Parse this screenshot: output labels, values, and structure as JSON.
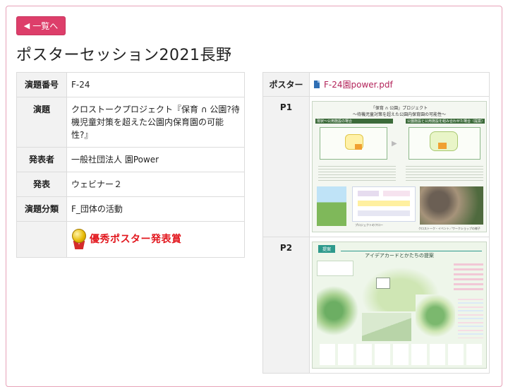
{
  "back_button": {
    "label": "一覧へ"
  },
  "page_title": "ポスターセッション2021長野",
  "info": {
    "rows": [
      {
        "label": "演題番号",
        "value": "F-24"
      },
      {
        "label": "演題",
        "value": "クロストークプロジェクト『保育 ∩ 公園?待機児童対策を超えた公園内保育園の可能性?』"
      },
      {
        "label": "発表者",
        "value": "一般社団法人 園Power"
      },
      {
        "label": "発表",
        "value": "ウェビナー２"
      },
      {
        "label": "演題分類",
        "value": "F_団体の活動"
      }
    ],
    "award": "優秀ポスター発表賞"
  },
  "poster": {
    "label": "ポスター",
    "file": "F-24園power.pdf",
    "p1_label": "P1",
    "p2_label": "P2",
    "p1_title": "「保育 ∩ 公園」プロジェクト",
    "p1_subtitle": "〜待機児童対策を超えた公園内保育園の可能性〜",
    "p1_left_heading": "現状〜公用施設の場合",
    "p1_right_heading": "公園施設と公用施設を組み合わせた場合（提案）",
    "p1_caption_left": "プロジェクトのフロー",
    "p1_caption_right": "クロストーク・イベント／ワークショップの様子",
    "p2_tag": "提案",
    "p2_title": "アイデアカードとかたちの提案"
  },
  "colors": {
    "accent": "#dd3e6a",
    "link": "#b3245a",
    "award": "#e2161d",
    "label_bg": "#f2f2f2"
  }
}
